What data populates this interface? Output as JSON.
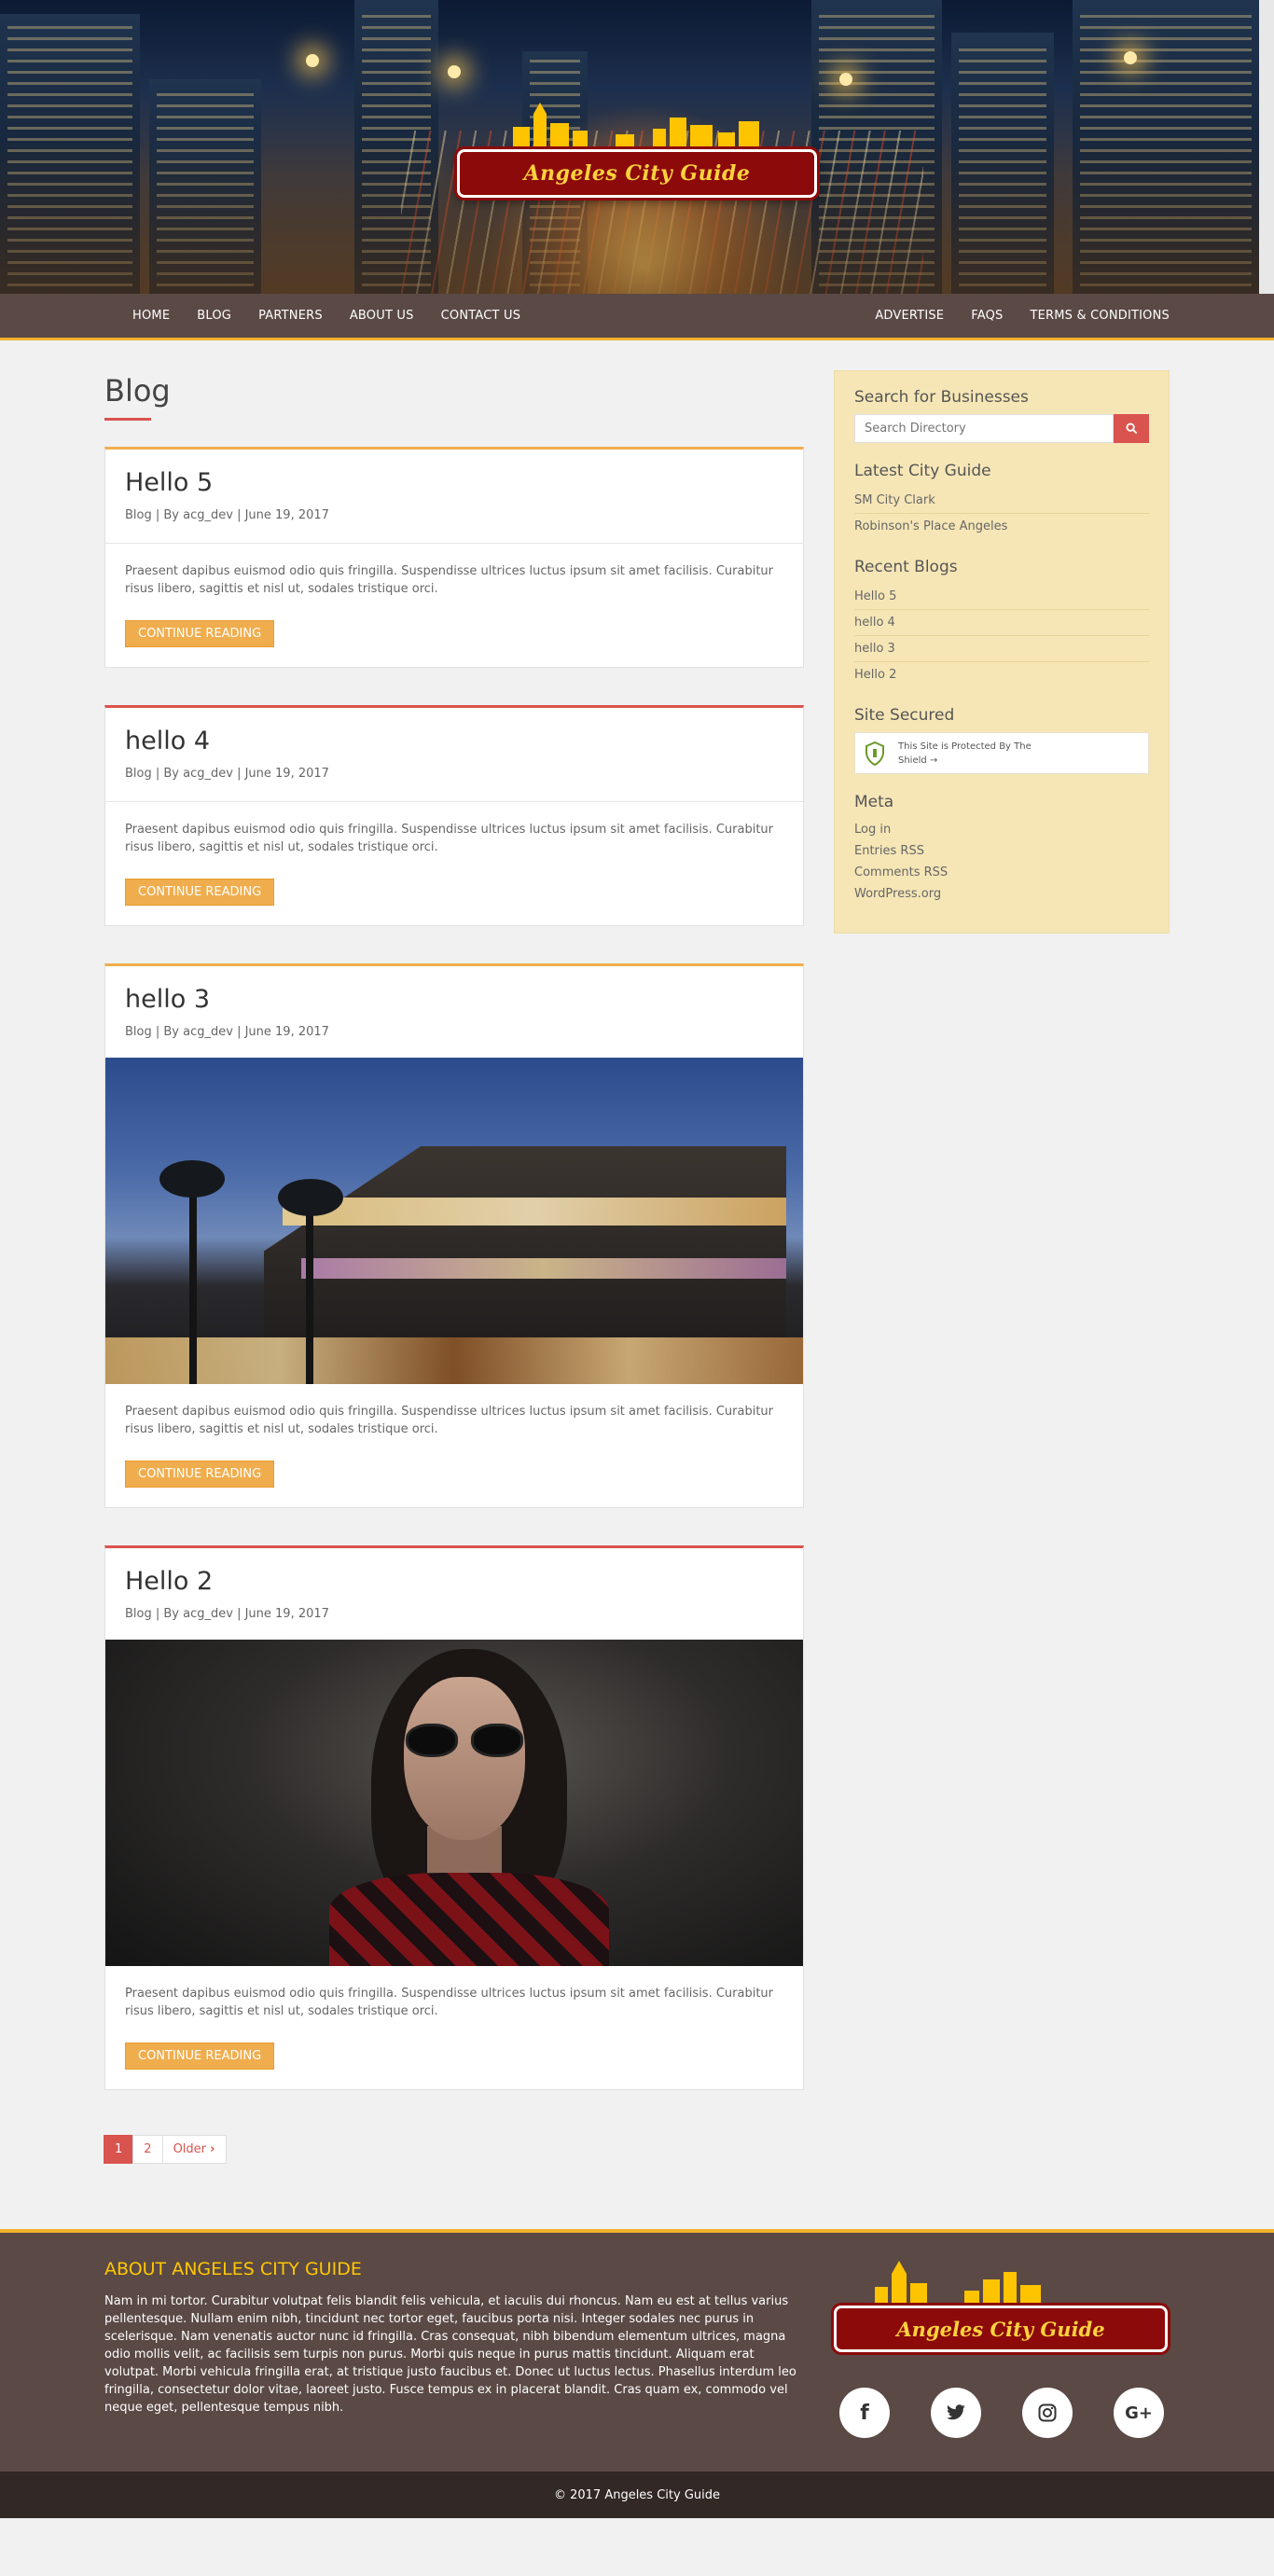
{
  "header": {
    "logo_text": "Angeles City Guide"
  },
  "nav": {
    "left": [
      "HOME",
      "BLOG",
      "PARTNERS",
      "ABOUT US",
      "CONTACT US"
    ],
    "right": [
      "ADVERTISE",
      "FAQS",
      "TERMS & CONDITIONS"
    ]
  },
  "page": {
    "title": "Blog"
  },
  "posts": [
    {
      "title": "Hello 5",
      "meta": "Blog | By acg_dev | June 19, 2017",
      "excerpt": "Praesent dapibus euismod odio quis fringilla. Suspendisse ultrices luctus ipsum sit amet facilisis. Curabitur risus libero, sagittis et nisl ut, sodales tristique orci.",
      "button": "CONTINUE READING",
      "image": null
    },
    {
      "title": "hello 4",
      "meta": "Blog | By acg_dev | June 19, 2017",
      "excerpt": "Praesent dapibus euismod odio quis fringilla. Suspendisse ultrices luctus ipsum sit amet facilisis. Curabitur risus libero, sagittis et nisl ut, sodales tristique orci.",
      "button": "CONTINUE READING",
      "image": null
    },
    {
      "title": "hello 3",
      "meta": "Blog | By acg_dev | June 19, 2017",
      "excerpt": "Praesent dapibus euismod odio quis fringilla. Suspendisse ultrices luctus ipsum sit amet facilisis. Curabitur risus libero, sagittis et nisl ut, sodales tristique orci.",
      "button": "CONTINUE READING",
      "image": "mall-at-dusk"
    },
    {
      "title": "Hello 2",
      "meta": "Blog | By acg_dev | June 19, 2017",
      "excerpt": "Praesent dapibus euismod odio quis fringilla. Suspendisse ultrices luctus ipsum sit amet facilisis. Curabitur risus libero, sagittis et nisl ut, sodales tristique orci.",
      "button": "CONTINUE READING",
      "image": "woman-sunglasses"
    }
  ],
  "pagination": {
    "pages": [
      "1",
      "2"
    ],
    "older": "Older"
  },
  "sidebar": {
    "search": {
      "title": "Search for Businesses",
      "placeholder": "Search Directory"
    },
    "latest": {
      "title": "Latest City Guide",
      "items": [
        "SM City Clark",
        "Robinson's Place Angeles"
      ]
    },
    "recent": {
      "title": "Recent Blogs",
      "items": [
        "Hello 5",
        "hello 4",
        "hello 3",
        "Hello 2"
      ]
    },
    "secured": {
      "title": "Site Secured",
      "badge_line1": "This Site is Protected By The",
      "badge_line2": "Shield →"
    },
    "meta": {
      "title": "Meta",
      "items": [
        "Log in",
        "Entries RSS",
        "Comments RSS",
        "WordPress.org"
      ]
    }
  },
  "footer": {
    "about_title": "ABOUT ANGELES CITY GUIDE",
    "about_text": "Nam in mi tortor. Curabitur volutpat felis blandit felis vehicula, et iaculis dui rhoncus. Nam eu est at tellus varius pellentesque. Nullam enim nibh, tincidunt nec tortor eget, faucibus porta nisi. Integer sodales nec purus in scelerisque. Nam venenatis auctor nunc id fringilla. Cras consequat, nibh bibendum elementum ultrices, magna odio mollis velit, ac facilisis sem turpis non purus. Morbi quis neque in purus mattis tincidunt. Aliquam erat volutpat. Morbi vehicula fringilla erat, at tristique justo faucibus et. Donec ut luctus lectus. Phasellus interdum leo fringilla, consectetur dolor vitae, laoreet justo. Fusce tempus ex in placerat blandit. Cras quam ex, commodo vel neque eget, pellentesque tempus nibh.",
    "logo_text": "Angeles City Guide",
    "socials": [
      "facebook-icon",
      "twitter-icon",
      "instagram-icon",
      "google-plus-icon"
    ],
    "copyright": "© 2017 Angeles City Guide"
  },
  "colors": {
    "accent_orange": "#f0ad4e",
    "accent_red": "#d9534f",
    "nav_brown": "#5a4944",
    "sidebar_bg": "#f6e6b6",
    "logo_red": "#8d0a0a",
    "logo_gold": "#ffd23d"
  }
}
